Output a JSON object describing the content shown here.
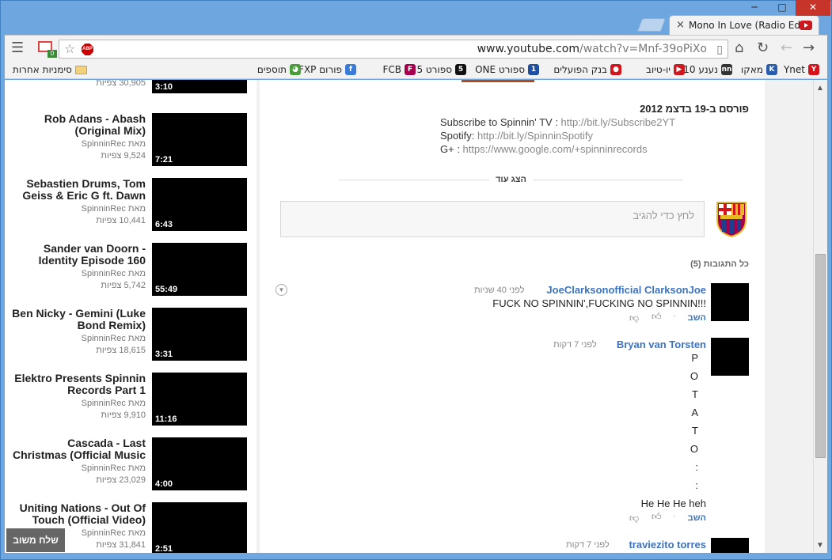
{
  "window": {
    "tab_title": "Mono In Love (Radio Edit)",
    "close_tab": "×",
    "minimize": "─",
    "maximize": "□",
    "close": "✕"
  },
  "toolbar": {
    "url_host": "www.youtube.com",
    "url_path": "/watch?v=Mnf-39oPiXo",
    "abp_label": "ABP",
    "gmail_count": "0"
  },
  "bookmarks": [
    {
      "label": "Ynet",
      "icon": "Y",
      "color": "#d4141a"
    },
    {
      "label": "מאקו",
      "icon": "K",
      "color": "#2a5dab"
    },
    {
      "label": "נענע 10",
      "icon": "nn",
      "color": "#333"
    },
    {
      "label": "יו-טיוב",
      "icon": "▶",
      "color": "#cc181e"
    },
    {
      "label": "בנק הפועלים",
      "icon": "●",
      "color": "#d4141a"
    },
    {
      "label": "ספורט ONE",
      "icon": "1",
      "color": "#1f4fa0"
    },
    {
      "label": "ספורט 5",
      "icon": "5",
      "color": "#111"
    },
    {
      "label": "FCB",
      "icon": "F",
      "color": "#a5004d"
    },
    {
      "label": "פורום FXP",
      "icon": "f",
      "color": "#3a7bd5"
    },
    {
      "label": "תוספים",
      "icon": "◕",
      "color": "#4a9d3a"
    }
  ],
  "bookmarks_other": "סימניות אחרות",
  "sidebar": {
    "items": [
      {
        "title": "",
        "by": "",
        "views": "30,905 צפיות",
        "duration": "3:10"
      },
      {
        "title": "Rob Adans - Abash (Original Mix)",
        "by": "מאת SpinninRec",
        "views": "9,524 צפיות",
        "duration": "7:21"
      },
      {
        "title": "Sebastien Drums, Tom Geiss & Eric G ft. Dawn",
        "by": "מאת SpinninRec",
        "views": "10,441 צפיות",
        "duration": "6:43"
      },
      {
        "title": "Sander van Doorn - Identity Episode 160",
        "by": "מאת SpinninRec",
        "views": "5,742 צפיות",
        "duration": "55:49"
      },
      {
        "title": "Ben Nicky - Gemini (Luke Bond Remix)",
        "by": "מאת SpinninRec",
        "views": "18,615 צפיות",
        "duration": "3:31"
      },
      {
        "title": "Elektro Presents Spinnin Records Part 1",
        "by": "מאת SpinninRec",
        "views": "9,910 צפיות",
        "duration": "11:16"
      },
      {
        "title": "Cascada - Last Christmas (Official Music",
        "by": "מאת SpinninRec",
        "views": "23,029 צפיות",
        "duration": "4:00"
      },
      {
        "title": "Uniting Nations - Out Of Touch (Official Video)",
        "by": "מאת SpinninRec",
        "views": "31,841 צפיות",
        "duration": "2:51"
      }
    ],
    "feedback": "שלח משוב"
  },
  "description": {
    "published": "פורסם ב-19 בדצמ 2012",
    "lines": [
      {
        "label": "Subscribe to Spinnin' TV : ",
        "link": "http://bit.ly/Subscribe2YT"
      },
      {
        "label": "Spotify: ",
        "link": "http://bit.ly/SpinninSpotify"
      },
      {
        "label": "G+ : ",
        "link": "https://www.google.com/+spinninrecords"
      }
    ],
    "show_more": "הצג עוד"
  },
  "comments": {
    "placeholder": "לחץ כדי להגיב",
    "all_label": "כל התגובות (5)",
    "items": [
      {
        "author": "JoeClarksonofficial ClarksonJoe",
        "time": "לפני 40 שניות",
        "text": "FUCK NO SPINNIN',FUCKING NO SPINNIN!!!",
        "reply": "השב"
      },
      {
        "author": "Bryan van Torsten",
        "time": "לפני 7 דקות",
        "letters": [
          "P",
          "O",
          "T",
          "A",
          "T",
          "O",
          ":",
          ":"
        ],
        "text": "He He He heh",
        "reply": "השב"
      },
      {
        "author": "traviezito torres",
        "time": "לפני 7 דקות"
      }
    ]
  },
  "scrollbar": {
    "up": "▲",
    "down": "▼"
  }
}
